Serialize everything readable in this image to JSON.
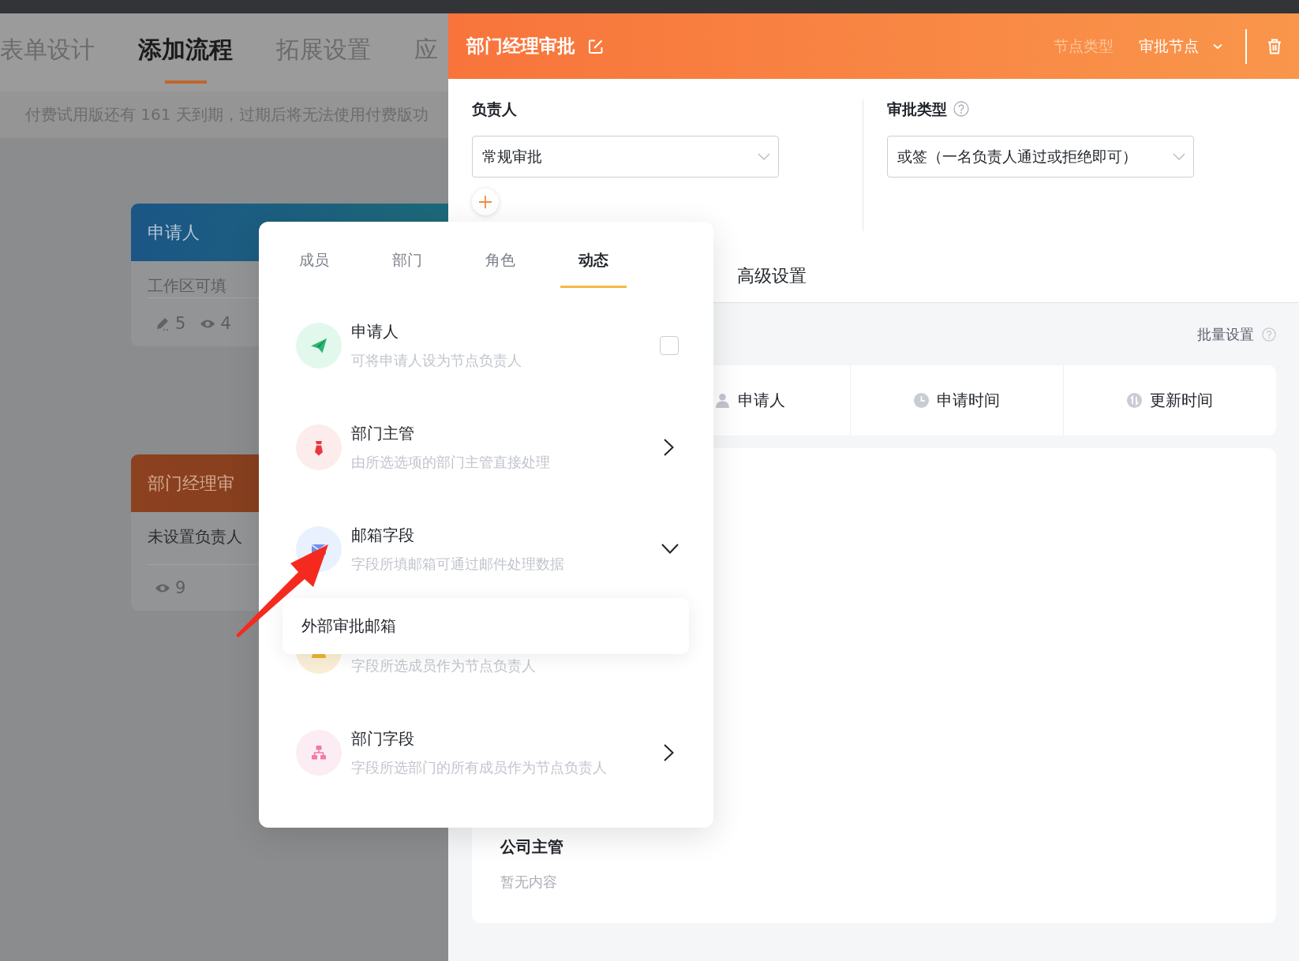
{
  "page": {
    "tabs": [
      {
        "label": "表单设计",
        "selected": false
      },
      {
        "label": "添加流程",
        "selected": true
      },
      {
        "label": "拓展设置",
        "selected": false
      },
      {
        "label": "应",
        "selected": false
      }
    ],
    "notice": "付费试用版还有 161 天到期，过期后将无法使用付费版功",
    "flow_nodes": [
      {
        "kind": "applicant",
        "title": "申请人",
        "body": "工作区可填",
        "stats": [
          {
            "kind": "edit",
            "value": "5"
          },
          {
            "kind": "view",
            "value": "4"
          }
        ]
      },
      {
        "kind": "approval",
        "title": "部门经理审",
        "body": "未设置负责人",
        "stats": [
          {
            "kind": "view",
            "value": "9"
          }
        ]
      }
    ]
  },
  "drawer": {
    "title": "部门经理审批",
    "node_type_label": "节点类型",
    "node_type": "审批节点",
    "assignee": {
      "label": "负责人",
      "value": "常规审批"
    },
    "approval_type": {
      "label": "审批类型",
      "value": "或签（一名负责人通过或拒绝即可）"
    },
    "tabs": [
      {
        "label": "高级设置"
      }
    ],
    "batch_setting": "批量设置",
    "columns": [
      {
        "kind": "person",
        "label": "申请人"
      },
      {
        "kind": "clock",
        "label": "申请时间"
      },
      {
        "kind": "sort",
        "label": "更新时间"
      }
    ],
    "groups": [
      {
        "title": "公司主管",
        "empty_text": "暂无内容"
      }
    ]
  },
  "picker": {
    "tabs": [
      {
        "label": "成员",
        "selected": false
      },
      {
        "label": "部门",
        "selected": false
      },
      {
        "label": "角色",
        "selected": false
      },
      {
        "label": "动态",
        "selected": true
      }
    ],
    "items": [
      {
        "kind": "plane",
        "title": "申请人",
        "description": "可将申请人设为节点负责人",
        "checked": false
      },
      {
        "kind": "tie",
        "title": "部门主管",
        "description": "由所选选项的部门主管直接处理",
        "expanded": false
      },
      {
        "kind": "envelope",
        "title": "邮箱字段",
        "description": "字段所填邮箱可通过邮件处理数据",
        "expanded": true,
        "options": [
          "外部审批邮箱"
        ]
      },
      {
        "kind": "person",
        "description": "字段所选成员作为节点负责人"
      },
      {
        "kind": "org",
        "title": "部门字段",
        "description": "字段所选部门的所有成员作为节点负责人",
        "expanded": false
      }
    ]
  },
  "annotations": [
    {
      "kind": "arrow"
    }
  ]
}
